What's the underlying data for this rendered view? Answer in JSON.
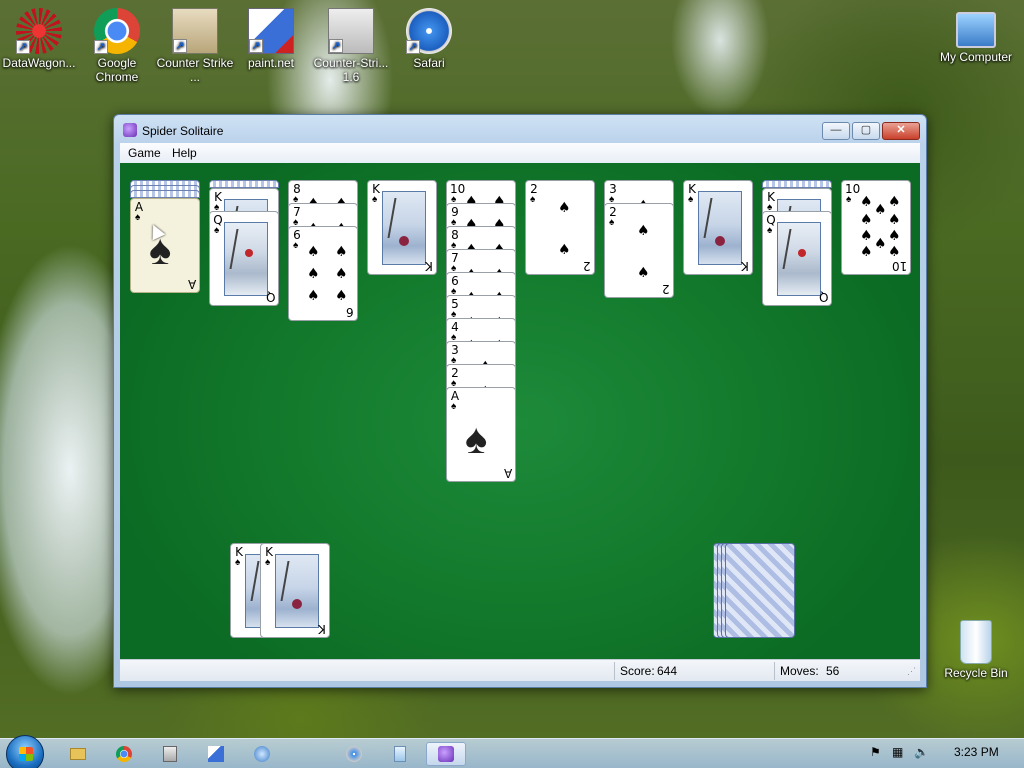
{
  "desktop": {
    "icons": [
      {
        "label": "DataWagon...",
        "icon": "datawagon-icon"
      },
      {
        "label": "Google Chrome",
        "icon": "chrome-icon"
      },
      {
        "label": "Counter Strike ...",
        "icon": "counter-strike-icon"
      },
      {
        "label": "paint.net",
        "icon": "paintnet-icon"
      },
      {
        "label": "Counter-Stri... 1.6",
        "icon": "counter-strike-16-icon"
      },
      {
        "label": "Safari",
        "icon": "safari-icon"
      },
      {
        "label": "My Computer",
        "icon": "computer-icon"
      },
      {
        "label": "Recycle Bin",
        "icon": "recycle-bin-icon"
      }
    ]
  },
  "window": {
    "title": "Spider Solitaire",
    "menu": [
      "Game",
      "Help"
    ],
    "controls": {
      "minimize": "—",
      "maximize": "▢",
      "close": "✕"
    }
  },
  "game": {
    "suit": "♠",
    "tableau": [
      {
        "hidden": 3,
        "cards": [
          "A"
        ]
      },
      {
        "hidden": 1,
        "cards": [
          "K",
          "Q"
        ]
      },
      {
        "hidden": 0,
        "cards": [
          "8",
          "7",
          "6"
        ]
      },
      {
        "hidden": 0,
        "cards": [
          "K"
        ]
      },
      {
        "hidden": 0,
        "cards": [
          "10",
          "9",
          "8",
          "7",
          "6",
          "5",
          "4",
          "3",
          "2",
          "A"
        ]
      },
      {
        "hidden": 0,
        "cards": [
          "2"
        ]
      },
      {
        "hidden": 0,
        "cards": [
          "3",
          "2"
        ]
      },
      {
        "hidden": 0,
        "cards": [
          "K"
        ]
      },
      {
        "hidden": 1,
        "cards": [
          "K",
          "Q"
        ]
      },
      {
        "hidden": 0,
        "cards": [
          "10"
        ]
      }
    ],
    "foundations": [
      "K",
      "K"
    ],
    "stock_piles": 4
  },
  "status": {
    "score_label": "Score:",
    "score": "644",
    "moves_label": "Moves:",
    "moves": "56"
  },
  "taskbar": {
    "items": [
      "explorer-icon",
      "chrome-icon",
      "counter-strike-icon",
      "paintnet-icon",
      "media-icon",
      "safari-icon",
      "notepad-icon",
      "spider-solitaire-icon"
    ],
    "clock": "3:23 PM"
  }
}
